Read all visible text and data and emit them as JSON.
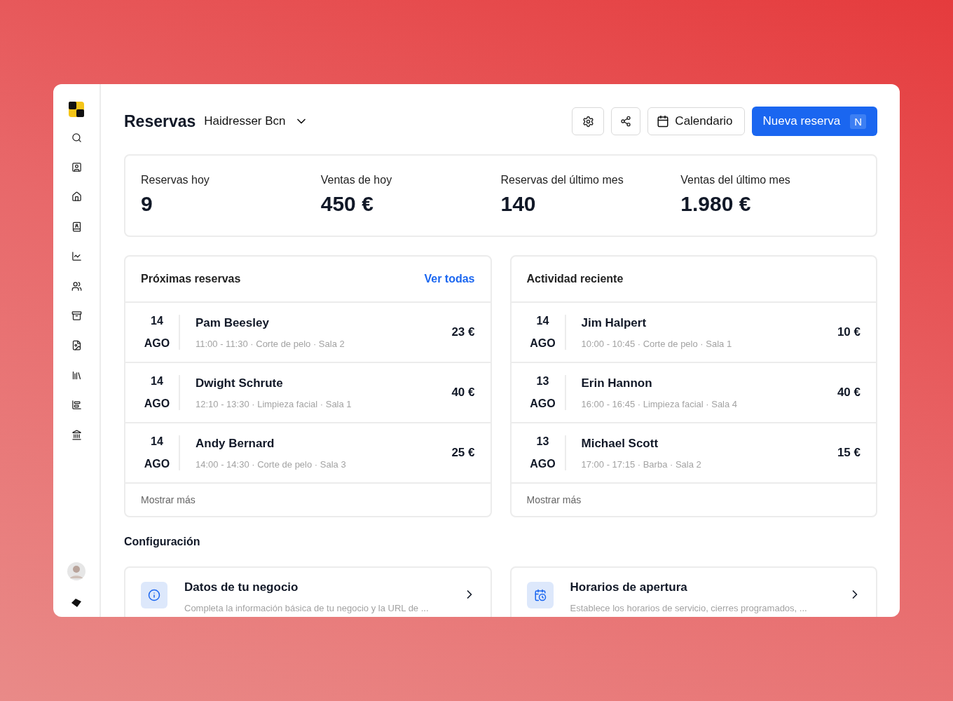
{
  "header": {
    "title": "Reservas",
    "business": "Haidresser Bcn",
    "calendar_button": "Calendario",
    "new_button": "Nueva reserva",
    "new_shortcut": "N"
  },
  "stats": [
    {
      "label": "Reservas hoy",
      "value": "9"
    },
    {
      "label": "Ventas de hoy",
      "value": "450 €"
    },
    {
      "label": "Reservas del último mes",
      "value": "140"
    },
    {
      "label": "Ventas del último mes",
      "value": "1.980 €"
    }
  ],
  "panels": [
    {
      "title": "Próximas reservas",
      "link": "Ver todas",
      "footer": "Mostrar más",
      "rows": [
        {
          "day": "14",
          "month": "AGO",
          "name": "Pam Beesley",
          "details": "11:00 - 11:30 · Corte de pelo · Sala 2",
          "price": "23 €"
        },
        {
          "day": "14",
          "month": "AGO",
          "name": "Dwight Schrute",
          "details": "12:10 - 13:30 · Limpieza facial · Sala 1",
          "price": "40 €"
        },
        {
          "day": "14",
          "month": "AGO",
          "name": "Andy Bernard",
          "details": "14:00 - 14:30 · Corte de pelo · Sala 3",
          "price": "25 €"
        }
      ]
    },
    {
      "title": "Actividad reciente",
      "footer": "Mostrar más",
      "rows": [
        {
          "day": "14",
          "month": "AGO",
          "name": "Jim Halpert",
          "details": "10:00 - 10:45 · Corte de pelo · Sala 1",
          "price": "10 €"
        },
        {
          "day": "13",
          "month": "AGO",
          "name": "Erin Hannon",
          "details": "16:00 - 16:45 · Limpieza facial · Sala 4",
          "price": "40 €"
        },
        {
          "day": "13",
          "month": "AGO",
          "name": "Michael Scott",
          "details": "17:00 - 17:15 · Barba · Sala 2",
          "price": "15 €"
        }
      ]
    }
  ],
  "settings": {
    "title": "Configuración",
    "cards": [
      {
        "kind": "info",
        "title": "Datos de tu negocio",
        "description": "Completa la información básica de tu negocio y la URL de ..."
      },
      {
        "kind": "schedule",
        "title": "Horarios de apertura",
        "description": "Establece los horarios de servicio, cierres programados, ..."
      }
    ]
  }
}
